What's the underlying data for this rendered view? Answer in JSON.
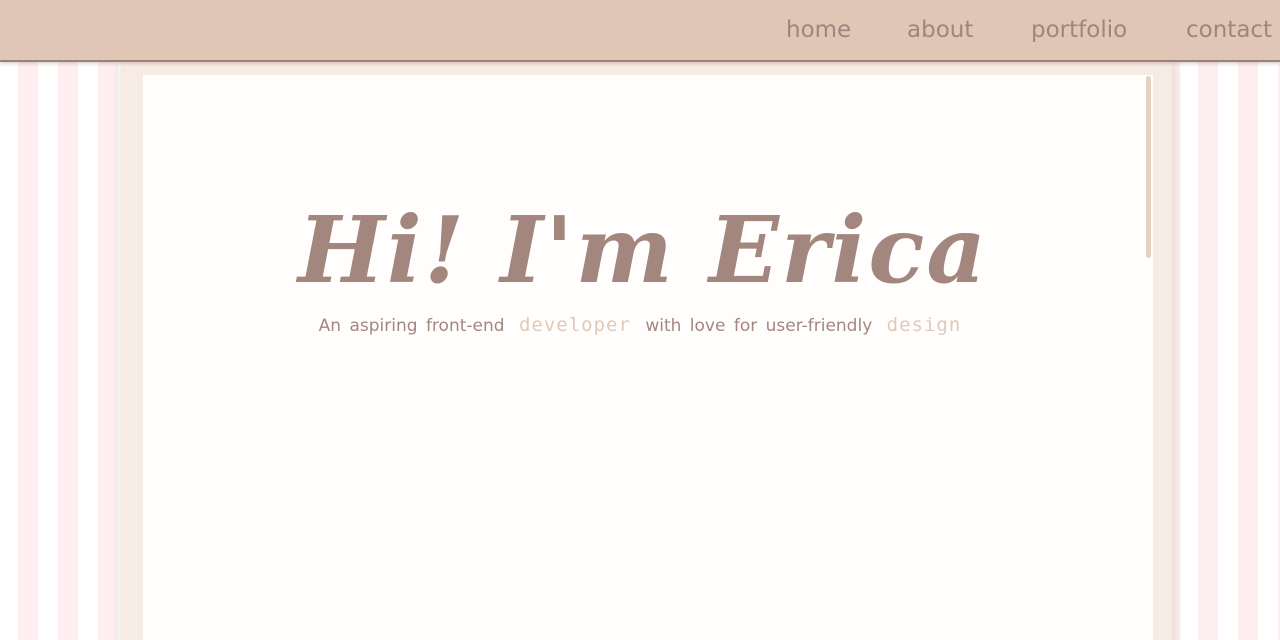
{
  "nav": {
    "links": [
      "home",
      "about",
      "portfolio",
      "contact"
    ]
  },
  "hero": {
    "title": "Hi! I'm Erica",
    "subtitle": {
      "part1": "An aspiring front-end",
      "accent1": "developer",
      "part2": "with love for user-friendly",
      "accent2": "design"
    }
  },
  "colors": {
    "nav_background": "#e0c7b5",
    "text": "#a3877f",
    "accent": "#e2c9b7",
    "panel": "#fffefc",
    "stripe_pink": "#fdeff0"
  }
}
